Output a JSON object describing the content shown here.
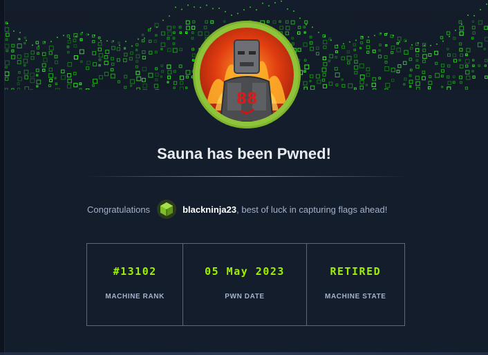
{
  "modal": {
    "title": "Sauna has been Pwned!",
    "congrats_prefix": "Congratulations",
    "username": "blackninja23",
    "congrats_suffix": ", best of luck in capturing flags ahead!"
  },
  "stats": [
    {
      "value": "#13102",
      "label": "MACHINE RANK"
    },
    {
      "value": "05 May 2023",
      "label": "PWN DATE"
    },
    {
      "value": "RETIRED",
      "label": "MACHINE STATE"
    }
  ],
  "colors": {
    "accent": "#9fef00",
    "ring": "#8ec43a",
    "background": "#141d2b",
    "text_muted": "#a4b1cd"
  },
  "icons": {
    "machine_avatar": "flaming-robot-avatar",
    "user_avatar": "green-cube-icon"
  }
}
